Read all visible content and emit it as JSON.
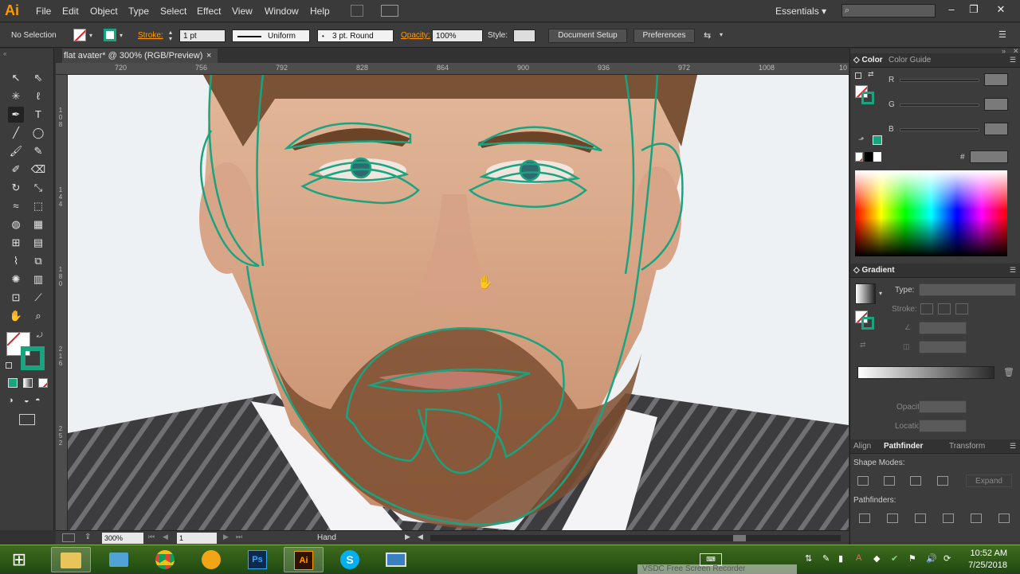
{
  "app": {
    "logo": "Ai"
  },
  "menu": [
    "File",
    "Edit",
    "Object",
    "Type",
    "Select",
    "Effect",
    "View",
    "Window",
    "Help"
  ],
  "workspace": {
    "label": "Essentials",
    "caret": "▾"
  },
  "window_controls": {
    "minimize": "–",
    "restore": "❐",
    "close": "✕"
  },
  "control": {
    "selection": "No Selection",
    "stroke_label": "Stroke:",
    "stroke_weight": "1 pt",
    "profile": "Uniform",
    "brush": "3 pt. Round",
    "opacity_label": "Opacity:",
    "opacity": "100%",
    "style_label": "Style:",
    "document_setup": "Document Setup",
    "preferences": "Preferences"
  },
  "document": {
    "tab_title": "flat avater* @ 300% (RGB/Preview)",
    "close": "×"
  },
  "ruler": {
    "top": [
      "720",
      "756",
      "792",
      "828",
      "864",
      "900",
      "936",
      "972",
      "1008",
      "10"
    ],
    "left": [
      "108",
      "144",
      "180",
      "216",
      "252"
    ]
  },
  "status": {
    "zoom": "300%",
    "artboard": "1",
    "tool": "Hand"
  },
  "color_panel": {
    "tabs": [
      "Color",
      "Color Guide"
    ],
    "channels": [
      "R",
      "G",
      "B"
    ],
    "hex_label": "#",
    "accent": "#1aa37f"
  },
  "gradient_panel": {
    "title": "Gradient",
    "type_label": "Type:",
    "stroke_label": "Stroke:",
    "opacity_label": "Opacity:",
    "location_label": "Location:"
  },
  "pathfinder_panel": {
    "tabs": [
      "Align",
      "Pathfinder",
      "Transform"
    ],
    "shape_modes": "Shape Modes:",
    "expand": "Expand",
    "pathfinders": "Pathfinders:"
  },
  "taskbar": {
    "time": "10:52 AM",
    "date": "7/25/2018",
    "recorder": "VSDC Free Screen Recorder"
  },
  "colors": {
    "path_stroke": "#1aa37f",
    "ai_orange": "#ff9a00"
  }
}
